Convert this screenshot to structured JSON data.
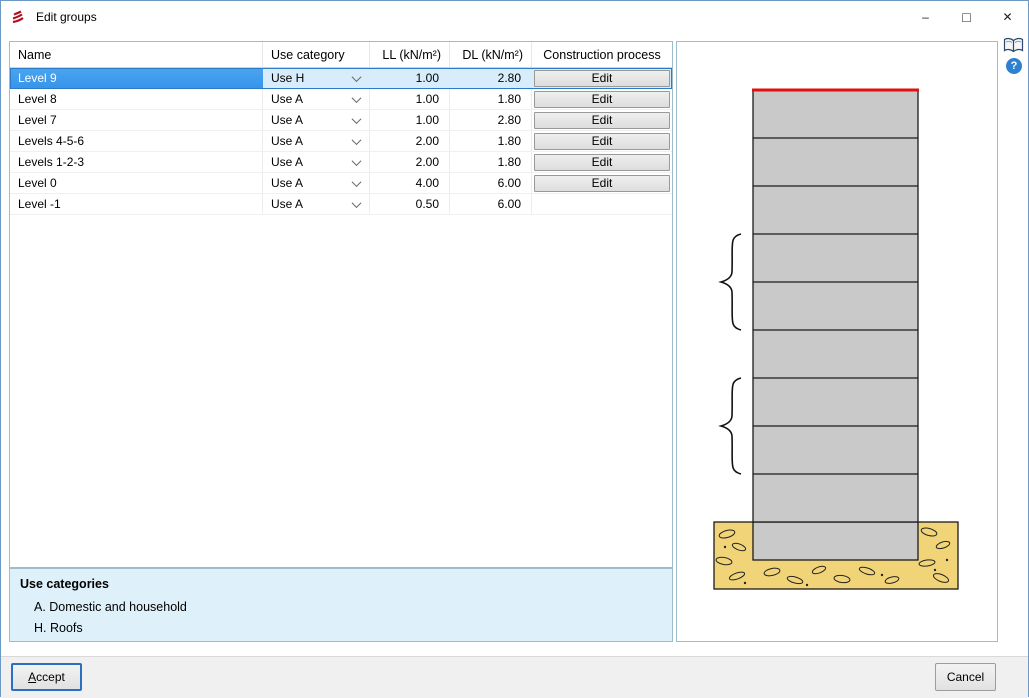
{
  "window": {
    "title": "Edit groups",
    "minimize_glyph": "–",
    "maximize_glyph": "□",
    "close_glyph": "✕"
  },
  "icons": {
    "help_glyph": "?"
  },
  "table": {
    "columns": {
      "name": "Name",
      "use_category": "Use category",
      "ll": "LL (kN/m²)",
      "dl": "DL (kN/m²)",
      "construction": "Construction process"
    },
    "rows": [
      {
        "name": "Level 9",
        "use_category": "Use H",
        "ll": "1.00",
        "dl": "2.80",
        "edit": "Edit"
      },
      {
        "name": "Level 8",
        "use_category": "Use A",
        "ll": "1.00",
        "dl": "1.80",
        "edit": "Edit"
      },
      {
        "name": "Level 7",
        "use_category": "Use A",
        "ll": "1.00",
        "dl": "2.80",
        "edit": "Edit"
      },
      {
        "name": "Levels 4-5-6",
        "use_category": "Use A",
        "ll": "2.00",
        "dl": "1.80",
        "edit": "Edit"
      },
      {
        "name": "Levels 1-2-3",
        "use_category": "Use A",
        "ll": "2.00",
        "dl": "1.80",
        "edit": "Edit"
      },
      {
        "name": "Level 0",
        "use_category": "Use A",
        "ll": "4.00",
        "dl": "6.00",
        "edit": "Edit"
      },
      {
        "name": "Level -1",
        "use_category": "Use A",
        "ll": "0.50",
        "dl": "6.00"
      }
    ]
  },
  "info_panel": {
    "title": "Use categories",
    "items": [
      "A. Domestic and household",
      "H. Roofs"
    ]
  },
  "footer": {
    "accept_mnemonic": "A",
    "accept_rest": "ccept",
    "cancel": "Cancel"
  },
  "colors": {
    "selection_header": "#3795ea",
    "selection_row": "#d8ecfb",
    "row_border": "#2a7cc9",
    "panel_border": "#9fbccc",
    "info_bg": "#def0f9",
    "help_blue": "#2f80d0",
    "accent_focus": "#2a6fc0",
    "roof_line": "#e01010",
    "floor_fill": "#c9c9c9",
    "soil_fill": "#f2d478"
  }
}
